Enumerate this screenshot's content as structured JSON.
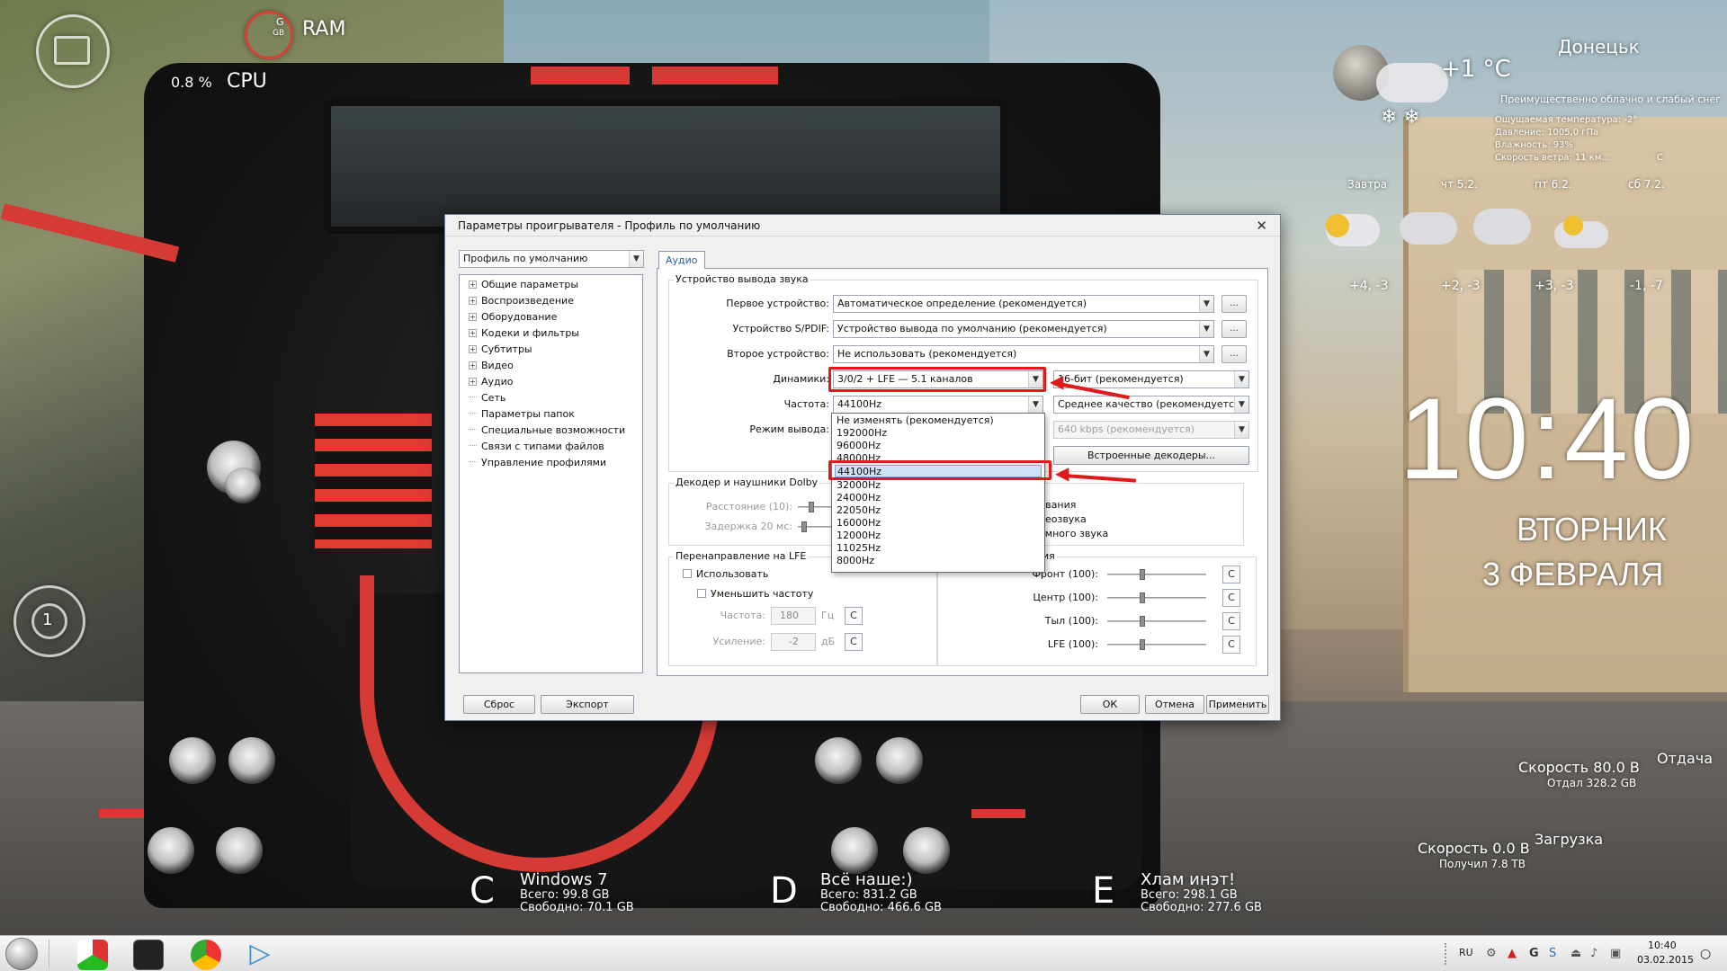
{
  "desktop": {
    "ram_label": "RAM",
    "ram_small": "G",
    "ram_unit": "GB",
    "cpu_value": "0.8 %",
    "cpu_label": "CPU",
    "side_gadget_number": "1",
    "city": "Донецьк",
    "temperature": "+1 °C",
    "weather_desc": "Преимущественно облачно и слабый снег",
    "weather_feel": "Ощущаемая температура: -2°",
    "weather_pressure": "Давление: 1005,0 гПа",
    "weather_humidity": "Влажность: 93%",
    "weather_wind": "Скорость ветра: 11 км...",
    "weather_wind_dir": "С",
    "forecast": [
      {
        "day": "Завтра",
        "temp": "+4, -3"
      },
      {
        "day": "чт 5.2.",
        "temp": "+2, -3"
      },
      {
        "day": "пт 6.2.",
        "temp": "+3, -3"
      },
      {
        "day": "сб 7.2.",
        "temp": "-1, -7"
      }
    ],
    "clock_time": "10:40",
    "clock_weekday": "ВТОРНИК",
    "clock_date": "3 ФЕВРАЛЯ",
    "net": {
      "upload_title": "Отдача",
      "upload_speed": "Скорость  80.0 В",
      "upload_total": "Отдал    328.2 GB",
      "download_title": "Загрузка",
      "download_speed": "Скорость   0.0 В",
      "download_total": "Получил    7.8 ТВ"
    },
    "drives": [
      {
        "letter": "C",
        "name": "Windows 7",
        "total": "Всего: 99.8 GB",
        "free": "Свободно: 70.1 GB"
      },
      {
        "letter": "D",
        "name": "Всё наше:)",
        "total": "Всего: 831.2 GB",
        "free": "Свободно: 466.6 GB"
      },
      {
        "letter": "E",
        "name": "Хлам инэт!",
        "total": "Всего: 298.1 GB",
        "free": "Свободно: 277.6 GB"
      }
    ]
  },
  "dialog": {
    "title": "Параметры проигрывателя - Профиль по умолчанию",
    "close": "✕",
    "profile_select": "Профиль по умолчанию",
    "tree": [
      {
        "label": "Общие параметры",
        "expandable": true
      },
      {
        "label": "Воспроизведение",
        "expandable": true
      },
      {
        "label": "Оборудование",
        "expandable": true
      },
      {
        "label": "Кодеки и фильтры",
        "expandable": true
      },
      {
        "label": "Субтитры",
        "expandable": true
      },
      {
        "label": "Видео",
        "expandable": true
      },
      {
        "label": "Аудио",
        "expandable": true
      },
      {
        "label": "Сеть",
        "expandable": false
      },
      {
        "label": "Параметры папок",
        "expandable": false
      },
      {
        "label": "Специальные возможности",
        "expandable": false
      },
      {
        "label": "Связи с типами файлов",
        "expandable": false
      },
      {
        "label": "Управление профилями",
        "expandable": false
      }
    ],
    "tab_audio": "Аудио",
    "output_group": "Устройство вывода звука",
    "first_device_label": "Первое устройство:",
    "first_device_value": "Автоматическое определение (рекомендуется)",
    "spdif_label": "Устройство S/PDIF:",
    "spdif_value": "Устройство вывода по умолчанию (рекомендуется)",
    "second_device_label": "Второе устройство:",
    "second_device_value": "Не использовать (рекомендуется)",
    "ellipsis": "...",
    "speakers_label": "Динамики:",
    "speakers_value": "3/0/2 + LFE — 5.1 каналов",
    "bits_value": "16-бит (рекомендуется)",
    "freq_label": "Частота:",
    "freq_value": "44100Hz",
    "quality_value": "Среднее качество (рекомендуется)",
    "output_mode_label": "Режим вывода:",
    "bitrate_value": "640 kbps (рекомендуется)",
    "builtin_decoders_button": "Встроенные декодеры...",
    "freq_options": [
      "Не изменять (рекомендуется)",
      "192000Hz",
      "96000Hz",
      "48000Hz",
      "44100Hz",
      "32000Hz",
      "24000Hz",
      "22050Hz",
      "16000Hz",
      "12000Hz",
      "11025Hz",
      "8000Hz"
    ],
    "dolby_group": "Декодер и наушники Dolby",
    "distance_label": "Расстояние (10):",
    "delay_label": "Задержка 20 мс:",
    "dolby_opt1": "ивания",
    "dolby_opt2": "реозвука",
    "dolby_opt3": "ёмного звука",
    "lfe_group": "Перенаправление на LFE",
    "use_check": "Использовать",
    "reduce_freq_check": "Уменьшить частоту",
    "freq_spin_label": "Частота:",
    "freq_spin_value": "180",
    "freq_unit": "Гц",
    "gain_label": "Усиление:",
    "gain_value": "-2",
    "gain_unit": "дБ",
    "c_button": "С",
    "gain_group_tail": "ия",
    "front_label": "Фронт (100):",
    "center_label": "Центр (100):",
    "rear_label": "Тыл (100):",
    "lfe_label": "LFE (100):",
    "reset_button": "Сброс",
    "export_button": "Экспорт",
    "ok_button": "ОК",
    "cancel_button": "Отмена",
    "apply_button": "Применить"
  },
  "taskbar": {
    "lang": "RU",
    "time": "10:40",
    "date": "03.02.2015"
  }
}
